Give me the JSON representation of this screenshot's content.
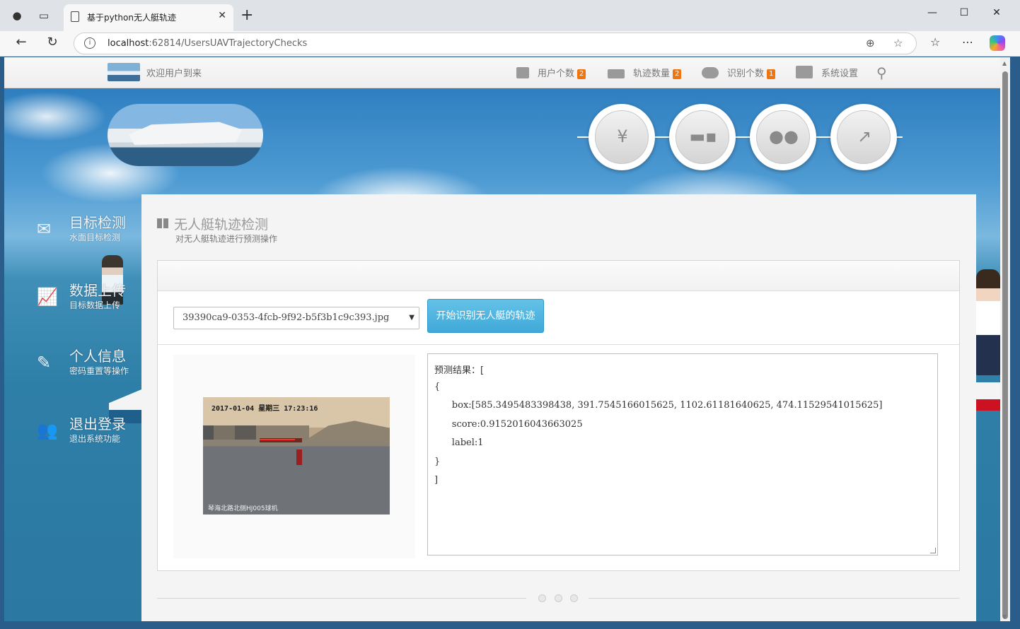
{
  "browser": {
    "tab_title": "基于python无人艇轨迹",
    "url_host": "localhost",
    "url_path": ":62814/UsersUAVTrajectoryChecks"
  },
  "navbar": {
    "welcome": "欢迎用户到来",
    "items": [
      {
        "label": "用户个数",
        "badge": "2",
        "icon": "document-icon"
      },
      {
        "label": "轨迹数量",
        "badge": "2",
        "icon": "envelope-icon"
      },
      {
        "label": "识别个数",
        "badge": "1",
        "icon": "cloud-icon"
      },
      {
        "label": "系统设置",
        "badge": "",
        "icon": "sliders-icon"
      }
    ]
  },
  "circles": [
    {
      "name": "coins-icon"
    },
    {
      "name": "truck-icon"
    },
    {
      "name": "chat-icon"
    },
    {
      "name": "line-chart-icon"
    }
  ],
  "sidemenu": [
    {
      "title": "目标检测",
      "subtitle": "水面目标检测",
      "icon": "envelope-icon"
    },
    {
      "title": "数据上传",
      "subtitle": "目标数据上传",
      "icon": "line-chart-icon"
    },
    {
      "title": "个人信息",
      "subtitle": "密码重置等操作",
      "icon": "edit-icon"
    },
    {
      "title": "退出登录",
      "subtitle": "退出系统功能",
      "icon": "users-icon"
    }
  ],
  "page": {
    "title": "无人艇轨迹检测",
    "subtitle": "对无人艇轨迹进行预测操作",
    "select_value": "39390ca9-0353-4fcb-9f92-b5f3b1c9c393.jpg",
    "button_label": "开始识别无人艇的轨迹",
    "photo_timestamp": "2017-01-04 星期三 17:23:16",
    "photo_caption": "琴海北路北侧HJ005球机",
    "result_lines": [
      "预测结果：[",
      "{",
      "      box:[585.3495483398438, 391.7545166015625, 1102.61181640625, 474.11529541015625]",
      "      score:0.9152016043663025",
      "      label:1",
      "}",
      "]"
    ]
  }
}
